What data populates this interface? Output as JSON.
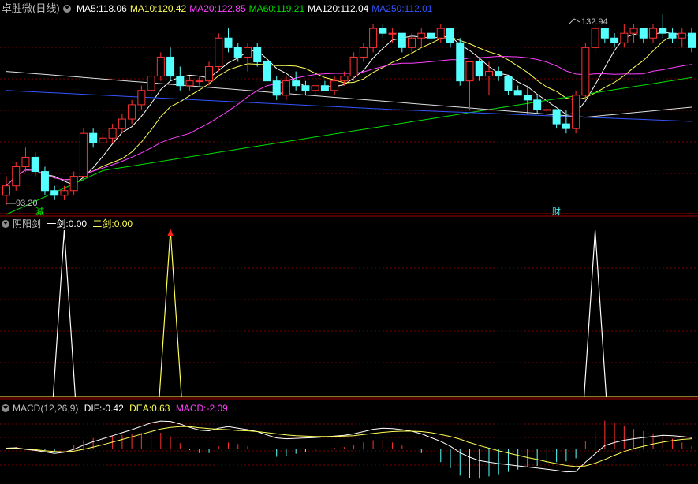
{
  "panels": {
    "price": {
      "title": "卓胜微(日线)",
      "ma": [
        {
          "label": "MA5:",
          "value": "118.06",
          "color": "#ffffff"
        },
        {
          "label": "MA10:",
          "value": "120.42",
          "color": "#ffff55"
        },
        {
          "label": "MA20:",
          "value": "122.85",
          "color": "#ff40ff"
        },
        {
          "label": "MA60:",
          "value": "119.21",
          "color": "#00dd00"
        },
        {
          "label": "MA120:",
          "value": "112.04",
          "color": "#ffffff"
        },
        {
          "label": "MA250:",
          "value": "112.01",
          "color": "#3355ff"
        }
      ],
      "high_label": "132.94",
      "low_label": "93.20",
      "marker_left": "減",
      "marker_right": "财"
    },
    "signal": {
      "title": "阴阳剑",
      "s1_label": "一剑:",
      "s1_value": "0.00",
      "s2_label": "二剑:",
      "s2_value": "0.00"
    },
    "macd": {
      "title": "MACD(12,26,9)",
      "dif_label": "DIF:",
      "dif_value": "-0.42",
      "dea_label": "DEA:",
      "dea_value": "0.63",
      "macd_label": "MACD:",
      "macd_value": "-2.09"
    }
  },
  "chart_data": [
    {
      "type": "candlestick",
      "candles": [
        [
          96,
          100,
          94,
          98
        ],
        [
          98,
          103,
          97,
          102
        ],
        [
          102,
          106,
          101,
          104
        ],
        [
          104,
          105,
          100,
          101
        ],
        [
          101,
          102,
          96,
          97
        ],
        [
          97,
          98,
          95,
          96
        ],
        [
          96,
          98,
          95,
          97
        ],
        [
          97,
          101,
          96,
          100
        ],
        [
          100,
          110,
          99,
          109
        ],
        [
          109,
          110,
          106,
          107
        ],
        [
          107,
          109,
          106,
          108
        ],
        [
          108,
          111,
          107,
          110
        ],
        [
          110,
          113,
          109,
          112
        ],
        [
          112,
          116,
          111,
          115
        ],
        [
          115,
          119,
          114,
          118
        ],
        [
          118,
          122,
          117,
          121
        ],
        [
          121,
          126,
          120,
          125
        ],
        [
          125,
          127,
          120,
          121
        ],
        [
          121,
          123,
          118,
          119
        ],
        [
          119,
          121,
          118,
          120
        ],
        [
          120,
          121,
          119,
          120
        ],
        [
          120,
          124,
          119,
          123
        ],
        [
          123,
          130,
          122,
          129
        ],
        [
          129,
          131,
          126,
          127
        ],
        [
          127,
          128,
          124,
          125
        ],
        [
          125,
          128,
          122,
          127
        ],
        [
          127,
          128,
          123,
          124
        ],
        [
          124,
          126,
          119,
          120
        ],
        [
          120,
          121,
          116,
          117
        ],
        [
          117,
          121,
          116,
          120
        ],
        [
          120,
          122,
          118,
          119
        ],
        [
          119,
          120,
          117,
          118
        ],
        [
          118,
          119,
          117,
          119
        ],
        [
          119,
          120,
          118,
          118
        ],
        [
          118,
          121,
          117,
          120
        ],
        [
          120,
          122,
          119,
          121
        ],
        [
          121,
          126,
          120,
          125
        ],
        [
          125,
          128,
          124,
          127
        ],
        [
          127,
          132,
          126,
          131
        ],
        [
          131,
          132,
          129,
          130
        ],
        [
          130,
          131,
          128,
          130
        ],
        [
          130,
          130,
          126,
          127
        ],
        [
          127,
          130,
          126,
          129
        ],
        [
          129,
          131,
          127,
          130
        ],
        [
          130,
          131,
          128,
          129
        ],
        [
          129,
          132,
          128,
          131
        ],
        [
          131,
          131,
          127,
          128
        ],
        [
          128,
          129,
          119,
          120
        ],
        [
          120,
          124,
          114,
          124
        ],
        [
          124,
          125,
          120,
          121
        ],
        [
          121,
          124,
          117,
          122
        ],
        [
          122,
          123,
          120,
          121
        ],
        [
          121,
          121,
          117,
          118
        ],
        [
          118,
          119,
          117,
          117
        ],
        [
          117,
          119,
          113,
          116
        ],
        [
          116,
          117,
          113,
          114
        ],
        [
          114,
          115,
          113,
          114
        ],
        [
          114,
          114,
          110,
          111
        ],
        [
          111,
          114,
          109,
          110
        ],
        [
          110,
          118,
          109,
          117
        ],
        [
          117,
          128,
          116,
          127
        ],
        [
          127,
          133,
          126,
          131
        ],
        [
          131,
          131,
          128,
          129
        ],
        [
          129,
          130,
          127,
          128
        ],
        [
          128,
          132,
          127,
          130
        ],
        [
          130,
          132,
          128,
          131
        ],
        [
          131,
          131,
          128,
          129
        ],
        [
          129,
          132,
          128,
          131
        ],
        [
          131,
          134,
          129,
          130
        ],
        [
          130,
          131,
          128,
          129
        ],
        [
          129,
          131,
          127,
          130
        ],
        [
          130,
          131,
          126,
          127
        ]
      ],
      "ma_series": [
        "MA5",
        "MA10",
        "MA20",
        "MA60",
        "MA120",
        "MA250"
      ],
      "yrange": [
        92,
        134
      ]
    },
    {
      "type": "line",
      "series": [
        {
          "name": "一剑",
          "values": [
            0,
            0,
            0,
            0,
            0,
            0,
            1,
            0,
            0,
            0,
            0,
            0,
            0,
            0,
            0,
            0,
            0,
            1,
            0,
            0,
            0,
            0,
            0,
            0,
            0,
            0,
            0,
            0,
            0,
            0,
            0,
            0,
            0,
            0,
            0,
            0,
            0,
            0,
            0,
            0,
            0,
            0,
            0,
            0,
            0,
            0,
            0,
            0,
            0,
            0,
            0,
            0,
            0,
            0,
            0,
            0,
            0,
            0,
            0,
            0,
            0,
            1,
            0,
            0,
            0,
            0,
            0,
            0,
            0,
            0,
            0,
            0
          ]
        }
      ],
      "ylim": [
        0,
        1
      ]
    },
    {
      "type": "bar",
      "dif": [
        0.1,
        0.2,
        -0.2,
        -0.5,
        -0.9,
        -1.3,
        -1.0,
        -0.2,
        0.9,
        1.8,
        2.6,
        3.4,
        4.2,
        5.0,
        5.9,
        6.8,
        7.3,
        7.2,
        6.5,
        5.6,
        4.9,
        4.7,
        5.4,
        5.8,
        5.4,
        5.0,
        4.5,
        3.6,
        2.8,
        2.6,
        2.7,
        2.8,
        2.9,
        3.1,
        3.3,
        3.5,
        3.9,
        4.5,
        5.1,
        5.4,
        5.3,
        5.0,
        4.6,
        3.9,
        2.9,
        1.9,
        0.6,
        -1.1,
        -2.3,
        -3.2,
        -3.6,
        -4.0,
        -4.3,
        -4.6,
        -4.9,
        -5.2,
        -5.5,
        -5.8,
        -6.2,
        -6.1,
        -3.6,
        -1.4,
        0.8,
        1.6,
        2.2,
        2.6,
        2.9,
        3.2,
        3.5,
        3.4,
        3.2,
        2.9
      ],
      "dea": [
        0.0,
        0.0,
        -0.1,
        -0.3,
        -0.6,
        -0.8,
        -0.9,
        -0.7,
        -0.2,
        0.4,
        1.0,
        1.7,
        2.4,
        3.1,
        3.8,
        4.5,
        5.2,
        5.6,
        5.8,
        5.8,
        5.5,
        5.3,
        5.1,
        5.0,
        4.8,
        4.7,
        4.5,
        4.2,
        3.9,
        3.6,
        3.4,
        3.3,
        3.2,
        3.2,
        3.2,
        3.3,
        3.4,
        3.7,
        4.0,
        4.3,
        4.5,
        4.6,
        4.6,
        4.5,
        4.2,
        3.7,
        3.2,
        2.5,
        1.6,
        0.8,
        0.1,
        -0.6,
        -1.2,
        -1.8,
        -2.4,
        -2.9,
        -3.5,
        -4.0,
        -4.5,
        -4.8,
        -4.6,
        -3.9,
        -2.9,
        -1.8,
        -0.8,
        0.0,
        0.6,
        1.2,
        1.7,
        2.1,
        2.4,
        2.6
      ],
      "macd": [
        0.2,
        0.4,
        -0.2,
        -0.4,
        -0.6,
        -1.0,
        -0.2,
        1.0,
        2.2,
        2.8,
        3.2,
        3.4,
        3.6,
        3.8,
        4.2,
        4.6,
        4.2,
        3.2,
        1.4,
        -0.4,
        -1.2,
        -1.2,
        0.6,
        1.6,
        1.2,
        0.6,
        0.0,
        -1.2,
        -2.2,
        -2.0,
        -1.4,
        -1.0,
        -0.6,
        -0.2,
        0.2,
        0.4,
        1.0,
        1.6,
        2.2,
        2.2,
        1.6,
        0.8,
        0.0,
        -1.2,
        -2.6,
        -3.6,
        -5.2,
        -7.2,
        -7.8,
        -8.0,
        -7.4,
        -6.8,
        -6.2,
        -5.6,
        -5.0,
        -4.6,
        -4.0,
        -3.6,
        -3.4,
        -2.6,
        2.0,
        5.0,
        7.4,
        6.8,
        6.0,
        5.2,
        4.6,
        4.0,
        3.6,
        2.6,
        1.6,
        0.6
      ],
      "ylim": [
        -9,
        9
      ]
    }
  ],
  "colors": {
    "up": "#ff3333",
    "down": "#54ffff",
    "grid": "#7a0000",
    "axis_border": "#a00000",
    "dif": "#ffffff",
    "dea": "#ffff55",
    "signal_line": "#ffffff",
    "signal_yellow": "#ffff55",
    "arrow": "#ff2020",
    "text_gray": "#c0c0c0"
  }
}
